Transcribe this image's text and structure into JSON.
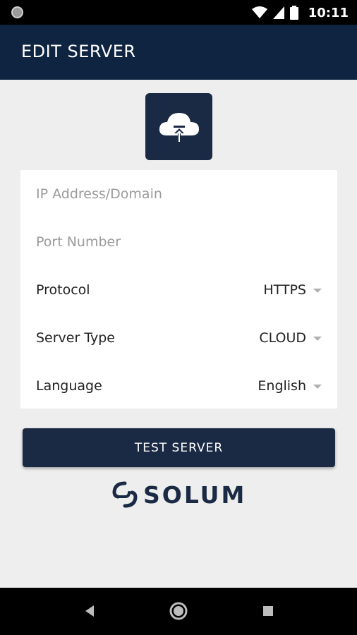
{
  "status_bar": {
    "time": "10:11",
    "icons": [
      "wifi-icon",
      "signal-icon",
      "battery-icon"
    ]
  },
  "app_bar": {
    "title": "EDIT SERVER"
  },
  "form": {
    "ip_placeholder": "IP Address/Domain",
    "port_placeholder": "Port Number",
    "protocol": {
      "label": "Protocol",
      "value": "HTTPS"
    },
    "server_type": {
      "label": "Server Type",
      "value": "CLOUD"
    },
    "language": {
      "label": "Language",
      "value": "English"
    }
  },
  "actions": {
    "test_button_label": "TEST SERVER"
  },
  "brand": {
    "logo_text": "SOLUM"
  },
  "colors": {
    "app_bar": "#0e2441",
    "accent": "#1b2a44",
    "background": "#eeeeee"
  }
}
